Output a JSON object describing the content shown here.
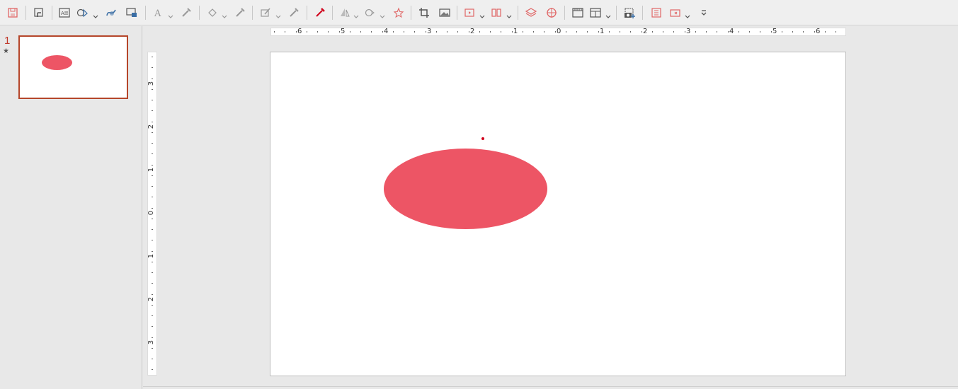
{
  "toolbar": {
    "items": [
      {
        "name": "save-icon",
        "color": "#e06666"
      },
      {
        "name": "zoom-pan-icon",
        "color": "#555555"
      },
      {
        "name": "text-box-icon",
        "color": "#555555"
      },
      {
        "name": "shapes-icon",
        "color": "#555555"
      },
      {
        "name": "curves-icon",
        "color": "#3a6ea5"
      },
      {
        "name": "connectors-icon",
        "color": "#3a6ea5"
      },
      {
        "name": "fontwork-icon",
        "color": "#999999"
      },
      {
        "name": "eyedropper-icon",
        "color": "#999999"
      },
      {
        "name": "fill-icon",
        "color": "#999999"
      },
      {
        "name": "line-color-icon",
        "color": "#999999"
      },
      {
        "name": "edit-points-icon",
        "color": "#999999"
      },
      {
        "name": "glue-points-icon",
        "color": "#999999"
      },
      {
        "name": "toggle-extrusion-icon",
        "color": "#d0021b"
      },
      {
        "name": "transformations-icon",
        "color": "#999999"
      },
      {
        "name": "align-icon",
        "color": "#999999"
      },
      {
        "name": "star-shapes-icon",
        "color": "#e06666"
      },
      {
        "name": "crop-icon",
        "color": "#555555"
      },
      {
        "name": "image-icon",
        "color": "#555555"
      },
      {
        "name": "insert-media-icon",
        "color": "#e06666"
      },
      {
        "name": "distribute-icon",
        "color": "#e06666"
      },
      {
        "name": "arrange-icon",
        "color": "#e06666"
      },
      {
        "name": "snap-guides-icon",
        "color": "#e06666"
      },
      {
        "name": "grid-icon",
        "color": "#555555"
      },
      {
        "name": "slide-layout-icon",
        "color": "#555555"
      },
      {
        "name": "snapshot-icon",
        "color": "#555555"
      },
      {
        "name": "slide-show-icon",
        "color": "#e06666"
      },
      {
        "name": "custom-animation-icon",
        "color": "#e06666"
      },
      {
        "name": "more-options-icon",
        "color": "#555555"
      }
    ]
  },
  "slide_pane": {
    "slide_number": "1",
    "star": "★",
    "active_border": "#b5462a"
  },
  "rulers": {
    "horizontal_labels": [
      "6",
      "5",
      "4",
      "3",
      "2",
      "1",
      "0",
      "1",
      "2",
      "3",
      "4",
      "5",
      "6"
    ],
    "vertical_labels": [
      "3",
      "2",
      "1",
      "0",
      "1",
      "2",
      "3"
    ]
  },
  "slide": {
    "shape": "ellipse",
    "shape_color": "#ed5565",
    "handle_color": "#d0021b"
  }
}
